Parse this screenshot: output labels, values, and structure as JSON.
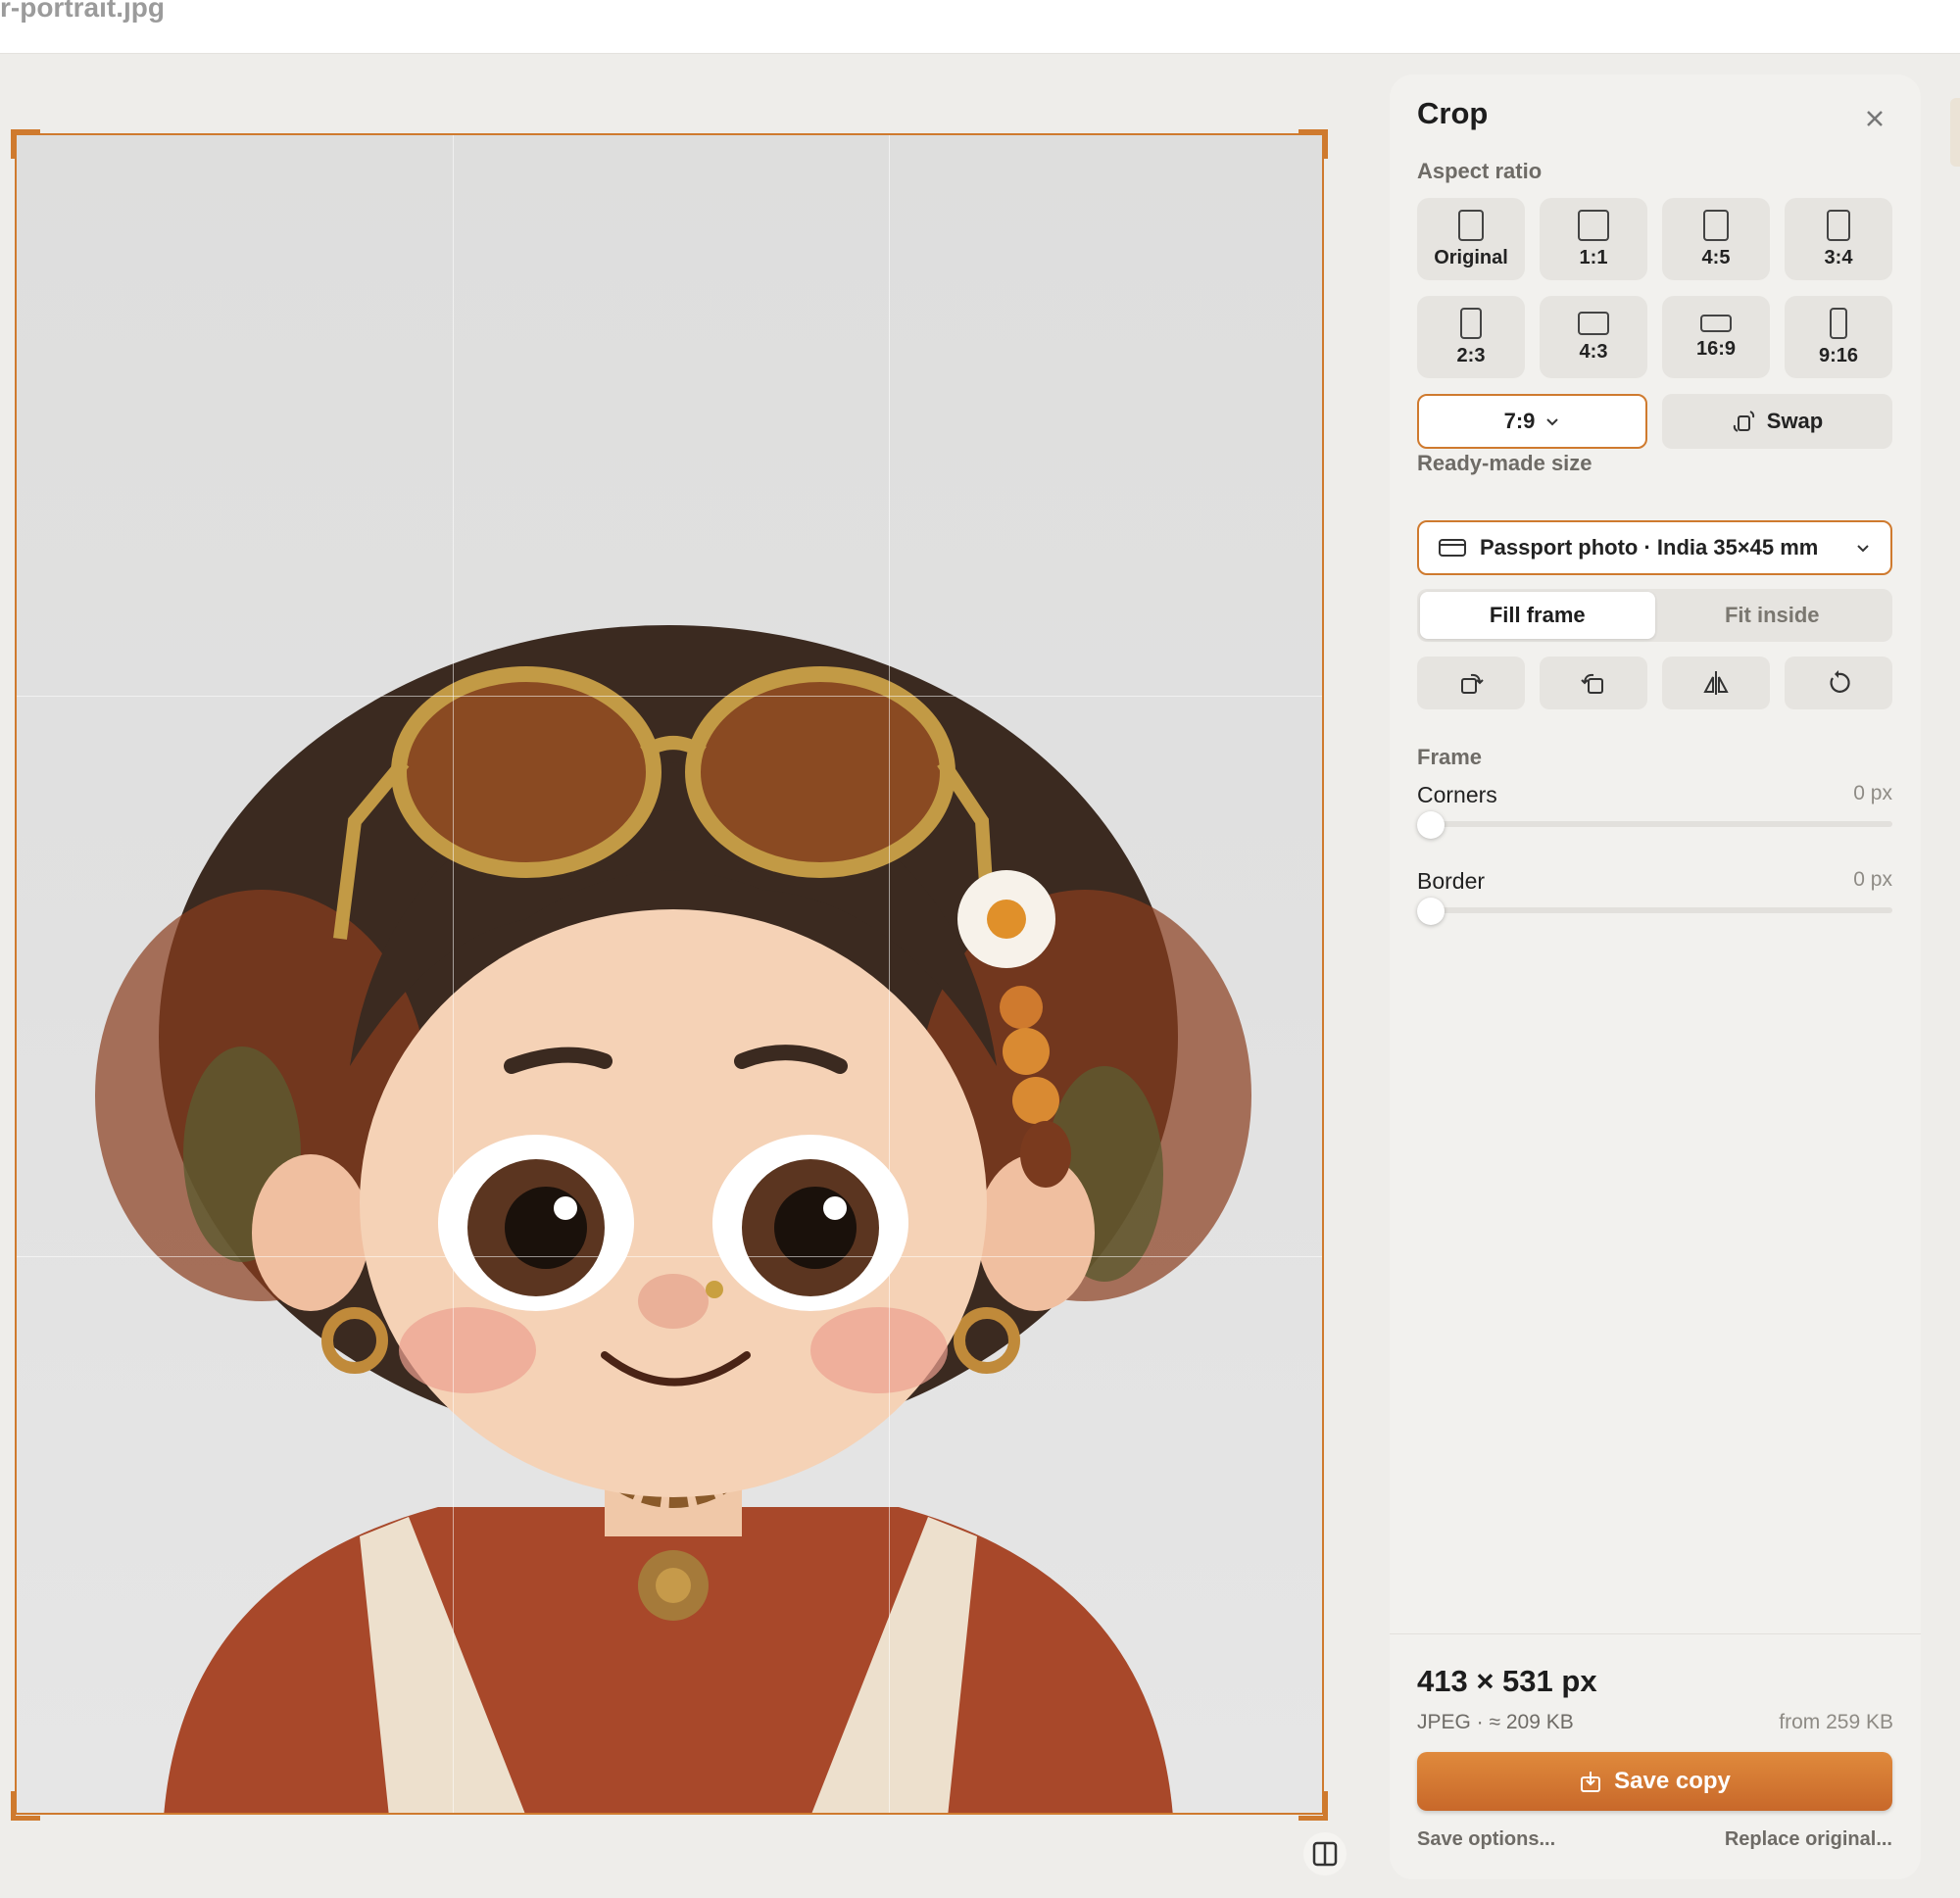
{
  "window": {
    "filename": "r-portrait.jpg"
  },
  "panel": {
    "title": "Crop",
    "aspect_ratio_label": "Aspect ratio",
    "ratios": [
      "Original",
      "1:1",
      "4:5",
      "3:4",
      "2:3",
      "4:3",
      "16:9",
      "9:16"
    ],
    "custom_ratio": "7:9",
    "swap_label": "Swap",
    "ready_made_label": "Ready-made size",
    "preset_value": "Passport photo · India 35×45 mm",
    "fit_modes": {
      "fill": "Fill frame",
      "fit": "Fit inside",
      "selected": "Fill frame"
    },
    "tools": [
      "rotate-right-icon",
      "rotate-left-icon",
      "flip-horizontal-icon",
      "reset-icon"
    ],
    "frame_label": "Frame",
    "corners": {
      "label": "Corners",
      "value": "0 px",
      "level": 0
    },
    "border": {
      "label": "Border",
      "value": "0 px",
      "level": 0
    }
  },
  "output": {
    "dimensions": "413 × 531 px",
    "meta": "JPEG · ≈ 209 KB",
    "from_size": "from 259 KB",
    "save_label": "Save copy",
    "save_options": "Save options...",
    "replace_original": "Replace original..."
  },
  "colors": {
    "accent": "#cf7a2e",
    "panel": "#f2f1ee",
    "background": "#eeedea"
  }
}
